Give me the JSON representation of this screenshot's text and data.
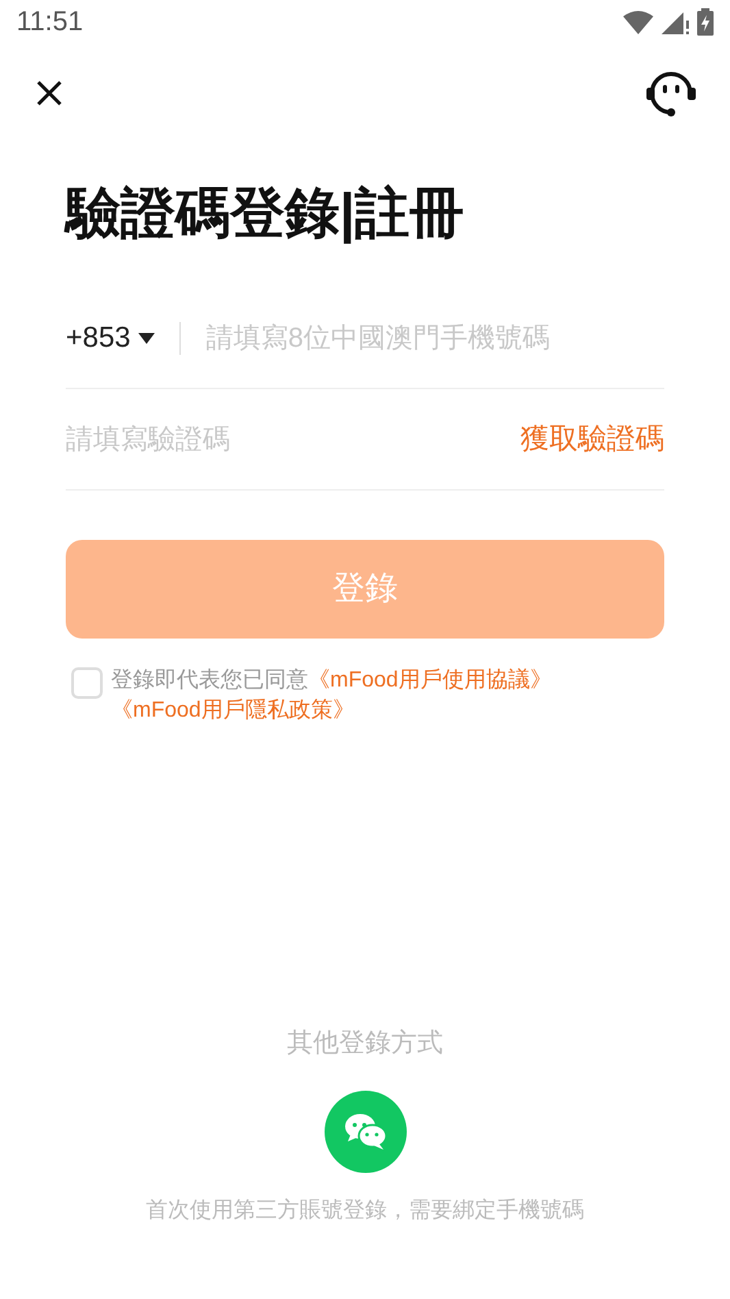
{
  "status_bar": {
    "time": "11:51"
  },
  "title": "驗證碼登錄|註冊",
  "phone_field": {
    "country_code": "+853",
    "placeholder": "請填寫8位中國澳門手機號碼"
  },
  "code_field": {
    "placeholder": "請填寫驗證碼",
    "action": "獲取驗證碼"
  },
  "login_button": {
    "label": "登錄",
    "disabled": true
  },
  "agreement": {
    "checked": false,
    "text": "登錄即代表您已同意",
    "links": [
      "《mFood用戶使用協議》",
      "《mFood用戶隱私政策》"
    ]
  },
  "other_login": {
    "heading": "其他登錄方式",
    "note": "首次使用第三方賬號登錄，需要綁定手機號碼"
  }
}
